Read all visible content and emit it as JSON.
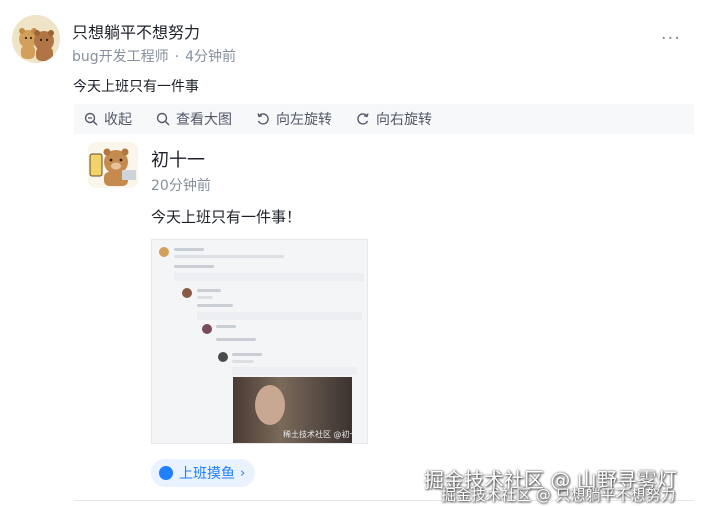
{
  "post": {
    "author": "只想躺平不想努力",
    "role": "bug开发工程师",
    "separator": "·",
    "time": "4分钟前",
    "more_label": "···",
    "text": "今天上班只有一件事"
  },
  "toolbar": {
    "items": [
      {
        "label": "收起",
        "icon": "zoom-out-icon"
      },
      {
        "label": "查看大图",
        "icon": "search-icon"
      },
      {
        "label": "向左旋转",
        "icon": "rotate-left-icon"
      },
      {
        "label": "向右旋转",
        "icon": "rotate-right-icon"
      }
    ]
  },
  "quoted": {
    "author": "初十一",
    "time": "20分钟前",
    "text": "今天上班只有一件事！",
    "image_watermark": "稀土技术社区 @初十一"
  },
  "topic": {
    "label": "上班摸鱼",
    "chevron": "›",
    "color": "#1e80ff"
  },
  "watermarks": {
    "line1": "掘金技术社区 @ 山野寻雾灯",
    "line2": "掘金技术社区 @ 只想躺平不想努力"
  }
}
